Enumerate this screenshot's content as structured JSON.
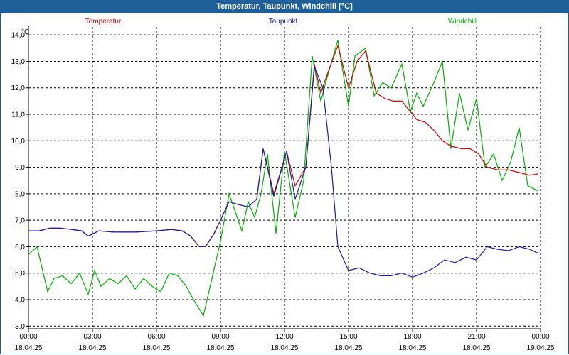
{
  "window": {
    "title": "Temperatur, Taupunkt, Windchill [°C]"
  },
  "chart_data": {
    "type": "line",
    "title": "Temperatur, Taupunkt, Windchill [°C]",
    "ylabel": "°C",
    "ylim": [
      2.9,
      14.3
    ],
    "xlim": [
      0,
      24
    ],
    "grid": true,
    "legend_placement": "top",
    "y_ticks": [
      "3,0",
      "4,0",
      "5,0",
      "6,0",
      "7,0",
      "8,0",
      "9,0",
      "10,0",
      "11,0",
      "12,0",
      "13,0",
      "14,0"
    ],
    "x_ticks": [
      {
        "time": "00:00",
        "date": "18.04.25"
      },
      {
        "time": "03:00",
        "date": "18.04.25"
      },
      {
        "time": "06:00",
        "date": "18.04.25"
      },
      {
        "time": "09:00",
        "date": "18.04.25"
      },
      {
        "time": "12:00",
        "date": "18.04.25"
      },
      {
        "time": "15:00",
        "date": "18.04.25"
      },
      {
        "time": "18:00",
        "date": "18.04.25"
      },
      {
        "time": "21:00",
        "date": "18.04.25"
      },
      {
        "time": "00:00",
        "date": "19.04.25"
      }
    ],
    "series": [
      {
        "name": "Temperatur",
        "color": "#cc0000",
        "points": [
          [
            0,
            6.6
          ],
          [
            0.5,
            6.6
          ],
          [
            1,
            6.7
          ],
          [
            1.5,
            6.7
          ],
          [
            2,
            6.65
          ],
          [
            2.5,
            6.6
          ],
          [
            2.8,
            6.4
          ],
          [
            3.3,
            6.6
          ],
          [
            4,
            6.55
          ],
          [
            5,
            6.55
          ],
          [
            6,
            6.6
          ],
          [
            6.7,
            6.65
          ],
          [
            7.2,
            6.6
          ],
          [
            7.6,
            6.4
          ],
          [
            8,
            6.0
          ],
          [
            8.3,
            6.0
          ],
          [
            8.7,
            6.5
          ],
          [
            9,
            7.0
          ],
          [
            9.4,
            7.7
          ],
          [
            9.8,
            7.6
          ],
          [
            10.3,
            7.5
          ],
          [
            10.7,
            7.8
          ],
          [
            11.0,
            9.7
          ],
          [
            11.5,
            8.0
          ],
          [
            12.1,
            9.6
          ],
          [
            12.5,
            8.3
          ],
          [
            13.0,
            9.0
          ],
          [
            13.4,
            12.9
          ],
          [
            13.7,
            11.8
          ],
          [
            14.0,
            12.5
          ],
          [
            14.5,
            13.6
          ],
          [
            15.0,
            12.0
          ],
          [
            15.4,
            13.0
          ],
          [
            15.8,
            13.4
          ],
          [
            16.3,
            11.8
          ],
          [
            16.7,
            11.6
          ],
          [
            17.1,
            11.5
          ],
          [
            17.5,
            11.5
          ],
          [
            17.8,
            11.2
          ],
          [
            18.2,
            10.8
          ],
          [
            18.6,
            10.7
          ],
          [
            19.0,
            10.4
          ],
          [
            19.4,
            10.0
          ],
          [
            19.8,
            9.8
          ],
          [
            20.3,
            9.7
          ],
          [
            20.7,
            9.7
          ],
          [
            21.1,
            9.5
          ],
          [
            21.5,
            9.0
          ],
          [
            22.0,
            8.9
          ],
          [
            22.5,
            8.9
          ],
          [
            23.0,
            8.8
          ],
          [
            23.5,
            8.7
          ],
          [
            23.9,
            8.75
          ]
        ]
      },
      {
        "name": "Taupunkt",
        "color": "#1a1aa6",
        "points": [
          [
            0,
            6.6
          ],
          [
            0.5,
            6.6
          ],
          [
            1,
            6.7
          ],
          [
            1.5,
            6.7
          ],
          [
            2,
            6.65
          ],
          [
            2.5,
            6.6
          ],
          [
            2.8,
            6.4
          ],
          [
            3.3,
            6.6
          ],
          [
            4,
            6.55
          ],
          [
            5,
            6.55
          ],
          [
            6,
            6.6
          ],
          [
            6.7,
            6.65
          ],
          [
            7.2,
            6.6
          ],
          [
            7.6,
            6.4
          ],
          [
            8,
            6.0
          ],
          [
            8.3,
            6.0
          ],
          [
            8.7,
            6.5
          ],
          [
            9,
            7.0
          ],
          [
            9.4,
            7.7
          ],
          [
            9.8,
            7.6
          ],
          [
            10.3,
            7.5
          ],
          [
            10.7,
            7.8
          ],
          [
            11.0,
            9.7
          ],
          [
            11.5,
            7.9
          ],
          [
            12.1,
            9.6
          ],
          [
            12.5,
            7.8
          ],
          [
            13.0,
            9.0
          ],
          [
            13.4,
            12.8
          ],
          [
            13.8,
            12.0
          ],
          [
            14.2,
            9.0
          ],
          [
            14.5,
            6.0
          ],
          [
            15.0,
            5.1
          ],
          [
            15.5,
            5.2
          ],
          [
            16.0,
            5.0
          ],
          [
            16.5,
            4.9
          ],
          [
            17.0,
            4.9
          ],
          [
            17.5,
            5.0
          ],
          [
            18.0,
            4.85
          ],
          [
            18.5,
            5.0
          ],
          [
            19.0,
            5.2
          ],
          [
            19.5,
            5.5
          ],
          [
            20.0,
            5.4
          ],
          [
            20.5,
            5.6
          ],
          [
            21.0,
            5.5
          ],
          [
            21.5,
            6.0
          ],
          [
            22.0,
            5.9
          ],
          [
            22.5,
            5.85
          ],
          [
            23.0,
            6.0
          ],
          [
            23.5,
            5.9
          ],
          [
            23.9,
            5.75
          ]
        ]
      },
      {
        "name": "Windchill",
        "color": "#00b000",
        "points": [
          [
            0,
            5.7
          ],
          [
            0.4,
            6.0
          ],
          [
            0.9,
            4.3
          ],
          [
            1.2,
            4.8
          ],
          [
            1.6,
            4.9
          ],
          [
            2.0,
            4.6
          ],
          [
            2.4,
            5.0
          ],
          [
            2.8,
            4.2
          ],
          [
            3.1,
            5.1
          ],
          [
            3.4,
            4.5
          ],
          [
            3.8,
            4.8
          ],
          [
            4.2,
            4.6
          ],
          [
            4.6,
            4.9
          ],
          [
            5.0,
            4.4
          ],
          [
            5.4,
            4.8
          ],
          [
            5.8,
            4.5
          ],
          [
            6.2,
            4.3
          ],
          [
            6.6,
            5.0
          ],
          [
            7.0,
            4.9
          ],
          [
            7.4,
            4.5
          ],
          [
            7.8,
            3.9
          ],
          [
            8.2,
            3.4
          ],
          [
            8.6,
            4.8
          ],
          [
            9.0,
            6.2
          ],
          [
            9.4,
            8.0
          ],
          [
            9.7,
            7.3
          ],
          [
            10.0,
            6.6
          ],
          [
            10.3,
            7.7
          ],
          [
            10.6,
            7.1
          ],
          [
            10.9,
            8.0
          ],
          [
            11.2,
            9.5
          ],
          [
            11.6,
            6.5
          ],
          [
            12.0,
            9.6
          ],
          [
            12.5,
            7.1
          ],
          [
            12.9,
            8.5
          ],
          [
            13.3,
            13.2
          ],
          [
            13.7,
            11.5
          ],
          [
            14.0,
            12.4
          ],
          [
            14.5,
            13.8
          ],
          [
            15.0,
            11.3
          ],
          [
            15.3,
            13.2
          ],
          [
            15.8,
            13.5
          ],
          [
            16.2,
            11.7
          ],
          [
            16.6,
            12.2
          ],
          [
            17.0,
            12.0
          ],
          [
            17.5,
            12.9
          ],
          [
            17.9,
            11.1
          ],
          [
            18.2,
            11.8
          ],
          [
            18.5,
            11.3
          ],
          [
            19.0,
            12.2
          ],
          [
            19.4,
            13.0
          ],
          [
            19.8,
            9.7
          ],
          [
            20.2,
            11.8
          ],
          [
            20.6,
            10.4
          ],
          [
            21.0,
            11.6
          ],
          [
            21.4,
            9.0
          ],
          [
            21.8,
            9.5
          ],
          [
            22.2,
            8.5
          ],
          [
            22.6,
            9.2
          ],
          [
            23.0,
            10.5
          ],
          [
            23.4,
            8.3
          ],
          [
            23.9,
            8.1
          ]
        ]
      }
    ]
  }
}
